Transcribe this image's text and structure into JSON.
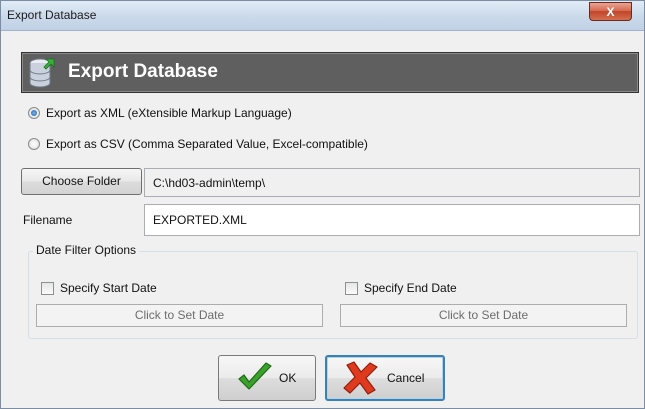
{
  "window": {
    "title": "Export Database",
    "close_glyph": "X"
  },
  "banner": {
    "title": "Export Database",
    "icon": "database-export-icon"
  },
  "format": {
    "xml_label": "Export as XML (eXtensible Markup Language)",
    "csv_label": "Export as CSV (Comma Separated Value, Excel-compatible)",
    "selected": "xml"
  },
  "folder": {
    "button_label": "Choose Folder",
    "path": "C:\\hd03-admin\\temp\\"
  },
  "filename": {
    "label": "Filename",
    "value": "EXPORTED.XML"
  },
  "date_filter": {
    "title": "Date Filter Options",
    "start_label": "Specify Start Date",
    "start_checked": false,
    "start_button": "Click to Set Date",
    "end_label": "Specify End Date",
    "end_checked": false,
    "end_button": "Click to Set Date"
  },
  "actions": {
    "ok_label": "OK",
    "cancel_label": "Cancel"
  },
  "colors": {
    "banner_bg": "#5f5f5f",
    "ok_check": "#3aa12b",
    "cancel_x": "#e03a1e",
    "focus_border": "#3c7fb1"
  }
}
